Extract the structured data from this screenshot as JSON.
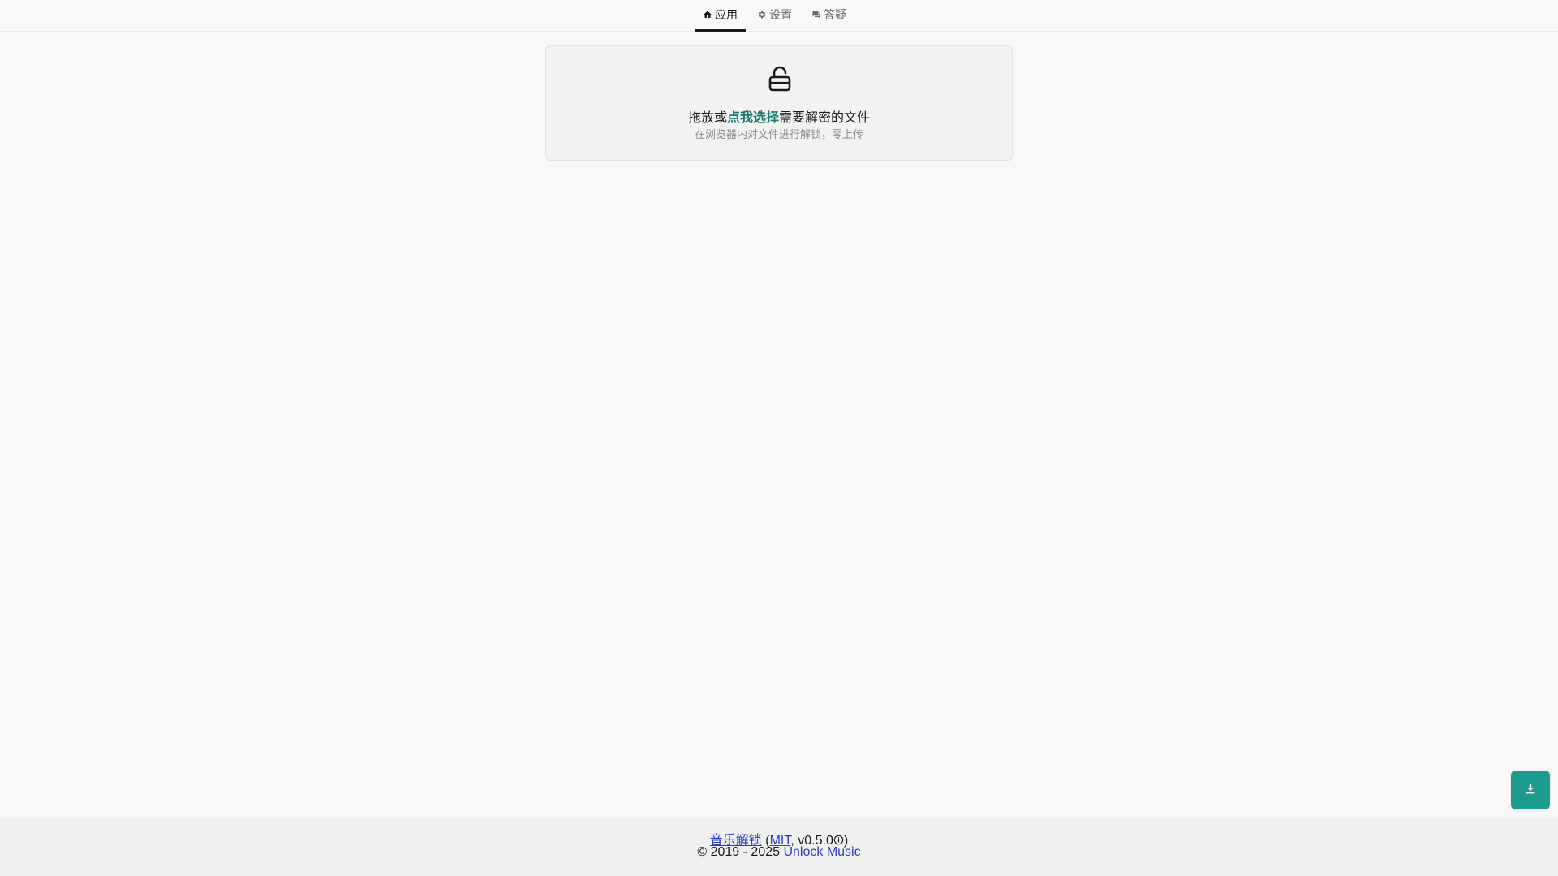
{
  "tabs": [
    {
      "label": "应用",
      "icon": "home-icon",
      "active": true
    },
    {
      "label": "设置",
      "icon": "gear-icon",
      "active": false
    },
    {
      "label": "答疑",
      "icon": "chat-icon",
      "active": false
    }
  ],
  "dropzone": {
    "icon": "unlock-icon",
    "title_before": "拖放或",
    "title_link": "点我选择",
    "title_after": "需要解密的文件",
    "subtitle": "在浏览器内对文件进行解锁，零上传"
  },
  "fab": {
    "icon": "download-icon"
  },
  "footer": {
    "app_link": "音乐解锁",
    "open_paren": " (",
    "license_link": "MIT",
    "version": ", v0.5.0",
    "close_paren": ")",
    "copyright": "© 2019 - 2025 ",
    "org_link": "Unlock Music"
  },
  "colors": {
    "accent": "#1e9b8f",
    "accent_text": "#1c7a6e",
    "link": "#2a3dc8",
    "background": "#f8f8f8",
    "footer_bg": "#f0f0f0"
  }
}
